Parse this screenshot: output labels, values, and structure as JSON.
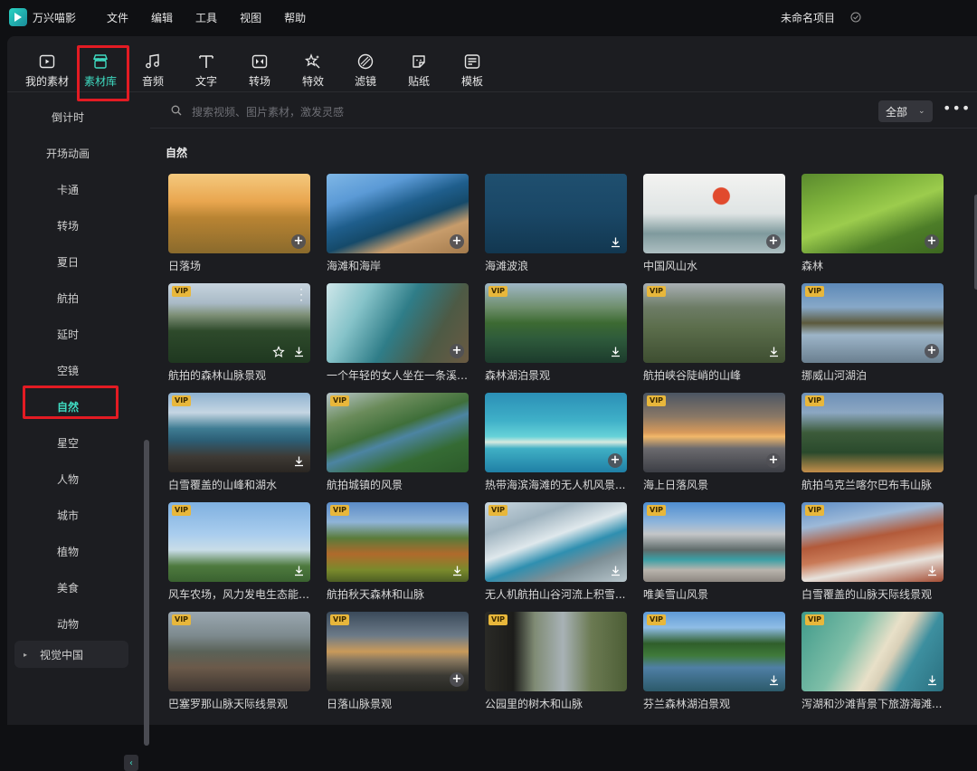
{
  "app": {
    "name": "万兴喵影",
    "project_name": "未命名项目"
  },
  "menu": [
    "文件",
    "编辑",
    "工具",
    "视图",
    "帮助"
  ],
  "toolbar": [
    {
      "label": "我的素材",
      "icon": "my-media-icon"
    },
    {
      "label": "素材库",
      "icon": "store-icon",
      "active": true
    },
    {
      "label": "音频",
      "icon": "music-icon"
    },
    {
      "label": "文字",
      "icon": "text-icon"
    },
    {
      "label": "转场",
      "icon": "transition-icon"
    },
    {
      "label": "特效",
      "icon": "effects-icon"
    },
    {
      "label": "滤镜",
      "icon": "filter-icon"
    },
    {
      "label": "贴纸",
      "icon": "sticker-icon"
    },
    {
      "label": "模板",
      "icon": "template-icon"
    }
  ],
  "sidebar": {
    "items": [
      {
        "label": "倒计时"
      },
      {
        "label": "开场动画"
      },
      {
        "label": "卡通"
      },
      {
        "label": "转场"
      },
      {
        "label": "夏日"
      },
      {
        "label": "航拍"
      },
      {
        "label": "延时"
      },
      {
        "label": "空镜"
      },
      {
        "label": "自然",
        "active": true
      },
      {
        "label": "星空"
      },
      {
        "label": "人物"
      },
      {
        "label": "城市"
      },
      {
        "label": "植物"
      },
      {
        "label": "美食"
      },
      {
        "label": "动物"
      }
    ],
    "group": {
      "label": "视觉中国"
    }
  },
  "search": {
    "placeholder": "搜索视频、图片素材，激发灵感",
    "filter_label": "全部"
  },
  "section_title": "自然",
  "cards": [
    {
      "title": "日落场",
      "vip": false,
      "action": "add",
      "bg": "linear-gradient(180deg,#f4c97e 0%,#e9a64f 35%,#b98433 55%,#8a6a2c 100%)"
    },
    {
      "title": "海滩和海岸",
      "vip": false,
      "action": "add",
      "bg": "linear-gradient(160deg,#7fb7e6 0%,#5b9ad6 25%,#1f5e8c 45%,#154a6a 60%,#c79c6b 75%,#a37a4c 100%)"
    },
    {
      "title": "海滩波浪",
      "vip": false,
      "action": "download",
      "bg": "linear-gradient(180deg,#1f4f6f 0%,#1a4766 50%,#123750 100%)"
    },
    {
      "title": "中国风山水",
      "vip": false,
      "action": "add",
      "bg": "radial-gradient(circle at 55% 28%,#e14a2d 0 9px,transparent 10px),linear-gradient(180deg,#f3f3f1 0%,#dfe4e4 50%,#7f9a9d 75%,#aebfc2 100%)"
    },
    {
      "title": "森林",
      "vip": false,
      "action": "add",
      "bg": "linear-gradient(160deg,#5a8a2e 0%,#7fb33c 30%,#9ccc4d 50%,#4d7d28 75%,#3c6620 100%)"
    },
    {
      "title": "航拍的森林山脉景观",
      "vip": true,
      "action": "download",
      "star": true,
      "dots": true,
      "bg": "linear-gradient(180deg,#c7d4de 0%,#a9bac6 25%,#7d8f76 40%,#2e4a2b 60%,#1f3820 100%)"
    },
    {
      "title": "一个年轻的女人坐在一条溪流...",
      "vip": false,
      "action": "add",
      "bg": "linear-gradient(120deg,#cfe7ea 0%,#86c3c9 25%,#2f7d88 50%,#4d5a45 75%,#6b5a42 100%)"
    },
    {
      "title": "森林湖泊景观",
      "vip": true,
      "action": "download",
      "bg": "linear-gradient(180deg,#9fb7c6 0%,#6f8f6d 30%,#3c6a32 50%,#2e5a3b 70%,#1c3b2c 100%)"
    },
    {
      "title": "航拍峡谷陡峭的山峰",
      "vip": true,
      "action": "download",
      "bg": "linear-gradient(180deg,#a9b0b4 0%,#6d7c66 30%,#5c6e4c 55%,#3e4e31 100%)"
    },
    {
      "title": "挪威山河湖泊",
      "vip": true,
      "action": "add",
      "bg": "linear-gradient(180deg,#5d89b8 0%,#87a8c8 30%,#5c5a3c 50%,#9db5c9 65%,#6a7f8f 100%)"
    },
    {
      "title": "白雪覆盖的山峰和湖水",
      "vip": true,
      "action": "download",
      "bg": "linear-gradient(180deg,#8fb2d0 0%,#c5d6e3 25%,#3f7c93 45%,#2c5e75 60%,#3e3a35 80%,#2a2622 100%)"
    },
    {
      "title": "航拍城镇的风景",
      "vip": true,
      "action": "none",
      "bg": "linear-gradient(160deg,#b7c5c9 0%,#6a8b5a 25%,#3f6f3a 45%,#4c84a2 55%,#356b34 75%,#2c5a2a 100%)"
    },
    {
      "title": "热带海滨海滩的无人机风景...",
      "vip": false,
      "action": "add",
      "bg": "linear-gradient(180deg,#2b8fb6 0%,#3fb0c8 35%,#66d2d8 55%,#d6e9df 62%,#40b0c5 70%,#1f7fa5 100%)"
    },
    {
      "title": "海上日落风景",
      "vip": true,
      "action": "add",
      "bg": "linear-gradient(180deg,#4b5563 0%,#8a7866 30%,#d89a5a 50%,#f2b86a 55%,#6b6a6e 70%,#3c3e45 100%)"
    },
    {
      "title": "航拍乌克兰喀尔巴布韦山脉",
      "vip": true,
      "action": "none",
      "bg": "linear-gradient(180deg,#6d90b8 0%,#8ca7c2 25%,#3c5b3a 50%,#2a4a2c 75%,#c58f4b 100%)"
    },
    {
      "title": "风车农场，风力发电生态能源...",
      "vip": true,
      "action": "download",
      "bg": "linear-gradient(180deg,#7fb0e0 0%,#a9cdee 40%,#c9dde8 60%,#4e7a3e 80%,#3a6230 100%)"
    },
    {
      "title": "航拍秋天森林和山脉",
      "vip": true,
      "action": "download",
      "bg": "linear-gradient(180deg,#5b8bc7 0%,#8fb4d8 25%,#5a7b3a 45%,#b06a2c 65%,#7a8a2c 85%,#4d5e24 100%)"
    },
    {
      "title": "无人机航拍山谷河流上积雪...",
      "vip": true,
      "action": "download",
      "bg": "linear-gradient(160deg,#c9d7e0 0%,#9fb3bf 25%,#dfe8ec 45%,#2f8fb0 60%,#7c8e95 75%,#b8c6cc 100%)"
    },
    {
      "title": "唯美雪山风景",
      "vip": true,
      "action": "none",
      "bg": "linear-gradient(180deg,#4f8ed1 0%,#8db4db 25%,#c4c6c8 40%,#5e6b6a 60%,#3a9fa5 72%,#b9b4ad 85%,#8c8680 100%)"
    },
    {
      "title": "白雪覆盖的山脉天际线景观",
      "vip": true,
      "action": "download",
      "bg": "linear-gradient(170deg,#5e8dc5 0%,#9db9d8 25%,#b25a3a 45%,#c97a57 60%,#e7e2dc 75%,#a44c33 100%)"
    },
    {
      "title": "巴塞罗那山脉天际线景观",
      "vip": true,
      "action": "none",
      "bg": "linear-gradient(180deg,#9aa7b0 0%,#7d8a8e 30%,#5a6258 50%,#6b5a4a 70%,#3d3530 100%)"
    },
    {
      "title": "日落山脉景观",
      "vip": true,
      "action": "add",
      "bg": "linear-gradient(180deg,#3a4a5a 0%,#6c7a88 30%,#c99a5a 50%,#8c7a60 60%,#3b3a34 80%,#262622 100%)"
    },
    {
      "title": "公园里的树木和山脉",
      "vip": true,
      "action": "none",
      "bg": "linear-gradient(90deg,#2a2a26 0%,#1c1c1a 20%,#7f8b74 35%,#a8b2b6 55%,#6b7a52 75%,#4d5e36 100%)"
    },
    {
      "title": "芬兰森林湖泊景观",
      "vip": true,
      "action": "download",
      "bg": "linear-gradient(180deg,#5f9ad6 0%,#8fbde6 20%,#2f5e2a 40%,#3f7a3a 55%,#4f7fa5 70%,#2c5a6a 100%)"
    },
    {
      "title": "泻湖和沙滩背景下旅游海滩...",
      "vip": true,
      "action": "download",
      "bg": "linear-gradient(120deg,#3f9a8a 0%,#7fbfa8 35%,#e8e0c8 55%,#d9d0b8 62%,#3d8f9f 75%,#2a6f7f 100%)"
    }
  ]
}
